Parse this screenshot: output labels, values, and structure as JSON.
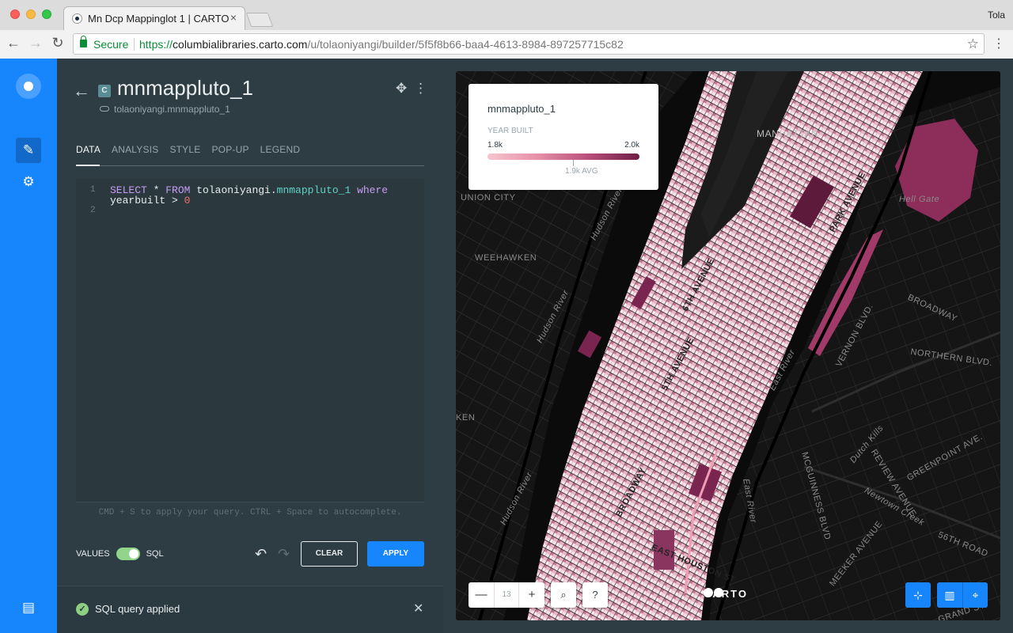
{
  "browser": {
    "tab_title": "Mn Dcp Mappinglot 1 | CARTO",
    "user": "Tola",
    "secure_label": "Secure",
    "url_scheme": "https://",
    "url_host": "columbialibraries.carto.com",
    "url_path": "/u/tolaoniyangi/builder/5f5f8b66-baa4-4613-8984-897257715c82"
  },
  "panel": {
    "layer_chip": "C",
    "layer_title": "mnmappluto_1",
    "layer_source": "tolaoniyangi.mnmappluto_1",
    "tabs": [
      "DATA",
      "ANALYSIS",
      "STYLE",
      "POP-UP",
      "LEGEND"
    ],
    "active_tab": "DATA",
    "editor": {
      "line_numbers": [
        "1",
        "2"
      ],
      "sql_keyword_select": "SELECT",
      "sql_star": " * ",
      "sql_keyword_from": "FROM",
      "sql_schema": " tolaoniyangi.",
      "sql_table": "mnmappluto_1",
      "sql_keyword_where": " where",
      "sql_line2a": "yearbuilt > ",
      "sql_line2b": "0"
    },
    "hint": "CMD + S to apply your query. CTRL + Space to autocomplete.",
    "toggle_values": "VALUES",
    "toggle_sql": "SQL",
    "clear_label": "CLEAR",
    "apply_label": "APPLY",
    "notification": "SQL query applied"
  },
  "map": {
    "legend": {
      "title": "mnmappluto_1",
      "subtitle": "YEAR BUILT",
      "min": "1.8k",
      "max": "2.0k",
      "avg": "1.9k AVG"
    },
    "zoom_level": "13",
    "attribution": "CARTO",
    "labels": {
      "manhattan": "MANHATTAN",
      "union_city": "UNION CITY",
      "weehawken": "WEEHAWKEN",
      "hell_gate": "Hell Gate",
      "broadway": "BROADWAY",
      "vernon": "VERNON BLVD.",
      "northern": "NORTHERN BLVD.",
      "greenpoint": "GREENPOINT AVE.",
      "review": "REVIEW AVENUE",
      "mcguinness": "MCGUINNESS BLVD",
      "meeker": "MEEKER AVENUE",
      "newtown": "Newtown Creek",
      "dutch_kills": "Dutch Kills",
      "east_river": "East River",
      "hudson_river": "Hudson River",
      "fifty_sixth": "56TH ROAD",
      "grand": "GRAND ST",
      "ken": "KEN",
      "houston": "EAST HOUSTON ST.",
      "fifth_ave": "5TH AVENUE",
      "sixth_ave": "6TH AVENUE",
      "broadway_m": "BROADWAY",
      "park_ave": "PARK AVENUE"
    },
    "colors": {
      "land": "#141414",
      "water": "#0a0a0a",
      "road": "#2a2a2a",
      "light": "#f4d5dc",
      "mid": "#d98aa3",
      "dark": "#7a2450"
    }
  }
}
